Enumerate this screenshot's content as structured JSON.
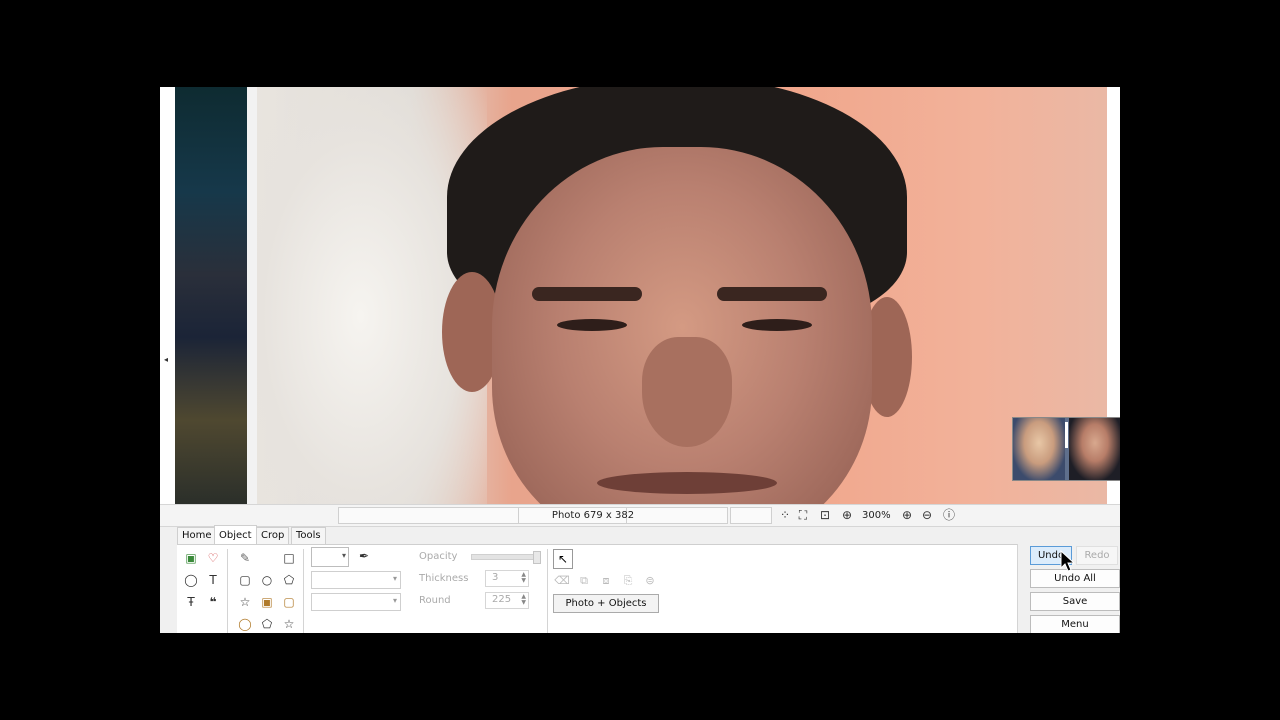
{
  "status": {
    "photo_info": "Photo 679 x 382",
    "zoom": "300%"
  },
  "tabs": [
    {
      "label": "Home"
    },
    {
      "label": "Object"
    },
    {
      "label": "Crop"
    },
    {
      "label": "Tools"
    }
  ],
  "active_tab": "Object",
  "properties": {
    "opacity_label": "Opacity",
    "thickness_label": "Thickness",
    "thickness_value": "3",
    "round_label": "Round",
    "round_value": "225"
  },
  "objects": {
    "photo_objects_label": "Photo + Objects"
  },
  "actions": {
    "undo": "Undo",
    "redo": "Redo",
    "undo_all": "Undo All",
    "save": "Save",
    "menu": "Menu"
  },
  "colors": {
    "active_button_bg": "#dcecfb",
    "active_button_border": "#5a9bd8"
  }
}
